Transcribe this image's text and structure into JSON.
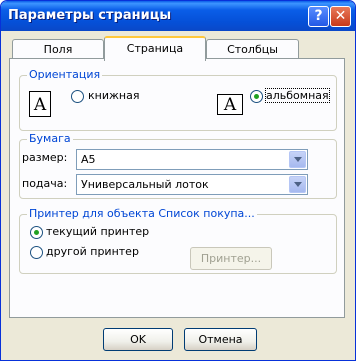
{
  "window": {
    "title": "Параметры страницы",
    "help_glyph": "?",
    "close_glyph": "✕"
  },
  "tabs": [
    {
      "label": "Поля",
      "active": false
    },
    {
      "label": "Страница",
      "active": true
    },
    {
      "label": "Столбцы",
      "active": false
    }
  ],
  "orientation": {
    "legend": "Ориентация",
    "portrait_label": "книжная",
    "landscape_label": "альбомная",
    "selected": "landscape",
    "icon_glyph": "A"
  },
  "paper": {
    "legend": "Бумага",
    "size_label": "размер:",
    "size_value": "A5",
    "feed_label": "подача:",
    "feed_value": "Универсальный лоток"
  },
  "printer": {
    "legend": "Принтер для объекта Список покупа...",
    "current_label": "текущий принтер",
    "other_label": "другой принтер",
    "printer_button": "Принтер...",
    "selected": "current"
  },
  "footer": {
    "ok": "OK",
    "cancel": "Отмена"
  },
  "colors": {
    "accent": "#0046d5",
    "title_bar": "#0a5ee8",
    "tab_highlight": "#ffc83c"
  }
}
